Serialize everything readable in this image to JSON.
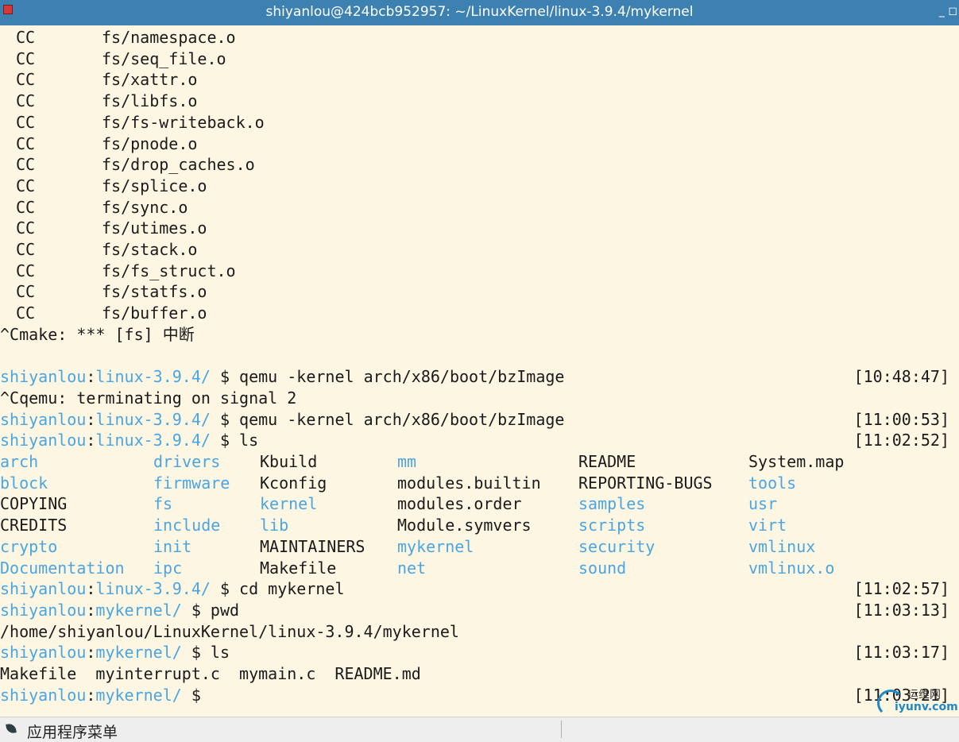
{
  "window": {
    "title": "shiyanlou@424bcb952957: ~/LinuxKernel/linux-3.9.4/mykernel",
    "controls": "_ ◻"
  },
  "terminal": {
    "cc_lines": [
      {
        "cmd": "CC",
        "file": "fs/namespace.o"
      },
      {
        "cmd": "CC",
        "file": "fs/seq_file.o"
      },
      {
        "cmd": "CC",
        "file": "fs/xattr.o"
      },
      {
        "cmd": "CC",
        "file": "fs/libfs.o"
      },
      {
        "cmd": "CC",
        "file": "fs/fs-writeback.o"
      },
      {
        "cmd": "CC",
        "file": "fs/pnode.o"
      },
      {
        "cmd": "CC",
        "file": "fs/drop_caches.o"
      },
      {
        "cmd": "CC",
        "file": "fs/splice.o"
      },
      {
        "cmd": "CC",
        "file": "fs/sync.o"
      },
      {
        "cmd": "CC",
        "file": "fs/utimes.o"
      },
      {
        "cmd": "CC",
        "file": "fs/stack.o"
      },
      {
        "cmd": "CC",
        "file": "fs/fs_struct.o"
      },
      {
        "cmd": "CC",
        "file": "fs/statfs.o"
      },
      {
        "cmd": "CC",
        "file": "fs/buffer.o"
      }
    ],
    "make_interrupt": "^Cmake: *** [fs] 中断",
    "prompt_user": "shiyanlou",
    "prompt_colon": ":",
    "dir_linux": "linux-3.9.4/",
    "dir_mykernel": "mykernel/",
    "cmd1": " $ qemu -kernel arch/x86/boot/bzImage",
    "ts1": "[10:48:47]",
    "qemu_term": "^Cqemu: terminating on signal 2",
    "cmd2": " $ qemu -kernel arch/x86/boot/bzImage",
    "ts2": "[11:00:53]",
    "cmd3": " $ ls",
    "ts3": "[11:02:52]",
    "ls_rows": [
      [
        {
          "t": "arch",
          "dir": true
        },
        {
          "t": "drivers",
          "dir": true
        },
        {
          "t": "Kbuild",
          "dir": false
        },
        {
          "t": "mm",
          "dir": true
        },
        {
          "t": "README",
          "dir": false
        },
        {
          "t": "System.map",
          "dir": false
        }
      ],
      [
        {
          "t": "block",
          "dir": true
        },
        {
          "t": "firmware",
          "dir": true
        },
        {
          "t": "Kconfig",
          "dir": false
        },
        {
          "t": "modules.builtin",
          "dir": false
        },
        {
          "t": "REPORTING-BUGS",
          "dir": false
        },
        {
          "t": "tools",
          "dir": true
        }
      ],
      [
        {
          "t": "COPYING",
          "dir": false
        },
        {
          "t": "fs",
          "dir": true
        },
        {
          "t": "kernel",
          "dir": true
        },
        {
          "t": "modules.order",
          "dir": false
        },
        {
          "t": "samples",
          "dir": true
        },
        {
          "t": "usr",
          "dir": true
        }
      ],
      [
        {
          "t": "CREDITS",
          "dir": false
        },
        {
          "t": "include",
          "dir": true
        },
        {
          "t": "lib",
          "dir": true
        },
        {
          "t": "Module.symvers",
          "dir": false
        },
        {
          "t": "scripts",
          "dir": true
        },
        {
          "t": "virt",
          "dir": true
        }
      ],
      [
        {
          "t": "crypto",
          "dir": true
        },
        {
          "t": "init",
          "dir": true
        },
        {
          "t": "MAINTAINERS",
          "dir": false
        },
        {
          "t": "mykernel",
          "dir": true
        },
        {
          "t": "security",
          "dir": true
        },
        {
          "t": "vmlinux",
          "dir": true
        }
      ],
      [
        {
          "t": "Documentation",
          "dir": true
        },
        {
          "t": "ipc",
          "dir": true
        },
        {
          "t": "Makefile",
          "dir": false
        },
        {
          "t": "net",
          "dir": true
        },
        {
          "t": "sound",
          "dir": true
        },
        {
          "t": "vmlinux.o",
          "dir": true
        }
      ]
    ],
    "cmd4": " $ cd mykernel",
    "ts4": "[11:02:57]",
    "cmd5": " $ pwd",
    "ts5": "[11:03:13]",
    "pwd_output": "/home/shiyanlou/LinuxKernel/linux-3.9.4/mykernel",
    "cmd6": " $ ls",
    "ts6": "[11:03:17]",
    "ls2_output": "Makefile  myinterrupt.c  mymain.c  README.md",
    "cmd7": " $",
    "ts7": "[11:03:21]"
  },
  "taskbar": {
    "menu_label": "应用程序菜单"
  },
  "watermark": {
    "cn": "运维网",
    "en": "iyunv.com"
  },
  "colors": {
    "background": "#fdf6e3",
    "titlebar": "#3d81b3",
    "prompt_blue": "#4aa5e0",
    "text": "#1a1a1a"
  }
}
